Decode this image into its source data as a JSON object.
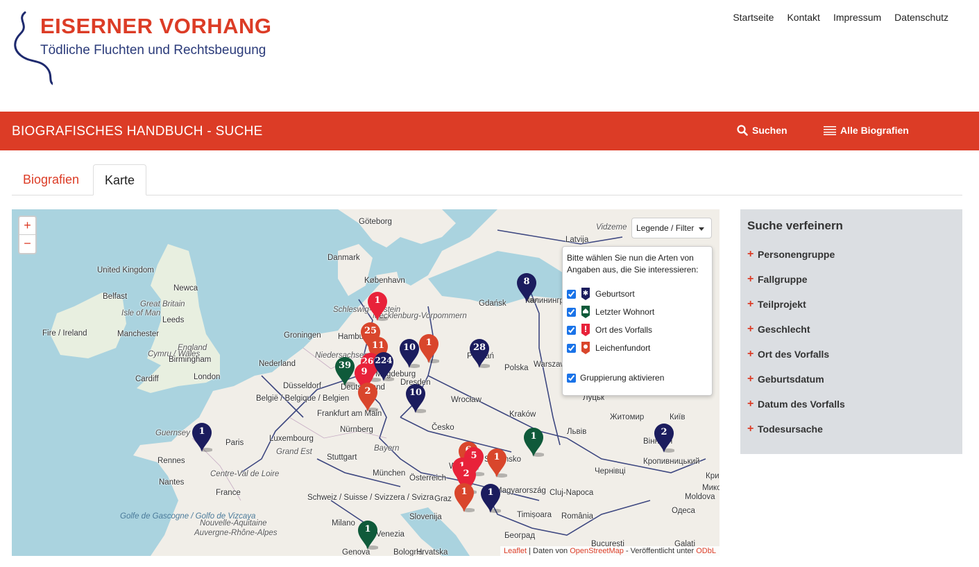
{
  "header": {
    "logo_title": "EISERNER VORHANG",
    "logo_subtitle": "Tödliche Fluchten und Rechtsbeugung",
    "nav": [
      "Startseite",
      "Kontakt",
      "Impressum",
      "Datenschutz"
    ]
  },
  "bar": {
    "title": "BIOGRAFISCHES HANDBUCH - SUCHE",
    "search_label": "Suchen",
    "all_label": "Alle Biografien",
    "color": "#dc3c26"
  },
  "tabs": [
    {
      "label": "Biografien",
      "active": false
    },
    {
      "label": "Karte",
      "active": true
    }
  ],
  "map": {
    "zoom_in": "+",
    "zoom_out": "−",
    "attribution": {
      "leaflet": "Leaflet",
      "sep1": " | Daten von ",
      "osm": "OpenStreetMap",
      "sep2": " - Veröffentlicht unter ",
      "odbl": "ODbL"
    },
    "places": [
      {
        "name": "Göteborg",
        "type": "city"
      },
      {
        "name": "Danmark",
        "type": "country"
      },
      {
        "name": "København",
        "type": "city"
      },
      {
        "name": "Latvija",
        "type": "country"
      },
      {
        "name": "Vidzeme",
        "type": "region"
      },
      {
        "name": "United Kingdom",
        "type": "country"
      },
      {
        "name": "Newca",
        "type": "city"
      },
      {
        "name": "Belfast",
        "type": "city"
      },
      {
        "name": "Great Britain",
        "type": "island"
      },
      {
        "name": "Isle of Man",
        "type": "island"
      },
      {
        "name": "Leeds",
        "type": "city"
      },
      {
        "name": "Fire / Ireland",
        "type": "country"
      },
      {
        "name": "Manchester",
        "type": "city"
      },
      {
        "name": "England",
        "type": "region"
      },
      {
        "name": "Cymru / Wales",
        "type": "region"
      },
      {
        "name": "Birmingham",
        "type": "city"
      },
      {
        "name": "Cardiff",
        "type": "city"
      },
      {
        "name": "London",
        "type": "city"
      },
      {
        "name": "Groningen",
        "type": "city"
      },
      {
        "name": "Nederland",
        "type": "country"
      },
      {
        "name": "Hamburg",
        "type": "city"
      },
      {
        "name": "Niedersachsen",
        "type": "region"
      },
      {
        "name": "Schleswig-Holstein",
        "type": "region"
      },
      {
        "name": "Mecklenburg-Vorpommern",
        "type": "region"
      },
      {
        "name": "Gdańsk",
        "type": "city"
      },
      {
        "name": "Калининград",
        "type": "city"
      },
      {
        "name": "Poznań",
        "type": "city"
      },
      {
        "name": "Warszawa",
        "type": "city"
      },
      {
        "name": "Polska",
        "type": "country"
      },
      {
        "name": "Düsseldorf",
        "type": "city"
      },
      {
        "name": "Deutschland",
        "type": "country"
      },
      {
        "name": "Magdeburg",
        "type": "city"
      },
      {
        "name": "Dresden",
        "type": "city"
      },
      {
        "name": "België / Belgique / Belgien",
        "type": "country"
      },
      {
        "name": "Frankfurt am Main",
        "type": "city"
      },
      {
        "name": "Wrocław",
        "type": "city"
      },
      {
        "name": "Луцьк",
        "type": "city"
      },
      {
        "name": "Київ",
        "type": "city"
      },
      {
        "name": "Житомир",
        "type": "city"
      },
      {
        "name": "Kraków",
        "type": "city"
      },
      {
        "name": "Česko",
        "type": "country"
      },
      {
        "name": "Львів",
        "type": "city"
      },
      {
        "name": "Guernsey",
        "type": "island"
      },
      {
        "name": "Paris",
        "type": "city"
      },
      {
        "name": "Luxembourg",
        "type": "city"
      },
      {
        "name": "Nürnberg",
        "type": "city"
      },
      {
        "name": "Bayern",
        "type": "region"
      },
      {
        "name": "Stuttgart",
        "type": "city"
      },
      {
        "name": "Grand Est",
        "type": "region"
      },
      {
        "name": "Rennes",
        "type": "city"
      },
      {
        "name": "Nantes",
        "type": "city"
      },
      {
        "name": "Centre-Val de Loire",
        "type": "region"
      },
      {
        "name": "France",
        "type": "country"
      },
      {
        "name": "München",
        "type": "city"
      },
      {
        "name": "Österreich",
        "type": "country"
      },
      {
        "name": "Wien",
        "type": "city"
      },
      {
        "name": "Slovensko",
        "type": "country"
      },
      {
        "name": "Magyarország",
        "type": "country"
      },
      {
        "name": "Cluj-Napoca",
        "type": "city"
      },
      {
        "name": "Чернівці",
        "type": "city"
      },
      {
        "name": "Кропивницький",
        "type": "city"
      },
      {
        "name": "Вінниця",
        "type": "city"
      },
      {
        "name": "Кривий Рі",
        "type": "city"
      },
      {
        "name": "Миколаї",
        "type": "city"
      },
      {
        "name": "Moldova",
        "type": "country"
      },
      {
        "name": "Одеса",
        "type": "city"
      },
      {
        "name": "Schweiz / Suisse / Svizzera / Svizra",
        "type": "country"
      },
      {
        "name": "Graz",
        "type": "city"
      },
      {
        "name": "Slovenija",
        "type": "country"
      },
      {
        "name": "Timișoara",
        "type": "city"
      },
      {
        "name": "România",
        "type": "country"
      },
      {
        "name": "Golfe de Gascogne / Golfo de Vizcaya",
        "type": "water"
      },
      {
        "name": "Nouvelle-Aquitaine",
        "type": "region"
      },
      {
        "name": "Auvergne-Rhône-Alpes",
        "type": "region"
      },
      {
        "name": "Milano",
        "type": "city"
      },
      {
        "name": "Venezia",
        "type": "city"
      },
      {
        "name": "Genova",
        "type": "city"
      },
      {
        "name": "Bologna",
        "type": "city"
      },
      {
        "name": "Hrvatska",
        "type": "country"
      },
      {
        "name": "Београд",
        "type": "city"
      },
      {
        "name": "București",
        "type": "city"
      },
      {
        "name": "Galați",
        "type": "city"
      }
    ],
    "markers": [
      {
        "count": "1",
        "kind": "vorfall"
      },
      {
        "count": "8",
        "kind": "geburt"
      },
      {
        "count": "25",
        "kind": "fund"
      },
      {
        "count": "11",
        "kind": "fund"
      },
      {
        "count": "1",
        "kind": "fund"
      },
      {
        "count": "10",
        "kind": "geburt"
      },
      {
        "count": "28",
        "kind": "geburt"
      },
      {
        "count": "39",
        "kind": "wohnort"
      },
      {
        "count": "260",
        "kind": "vorfall"
      },
      {
        "count": "224",
        "kind": "geburt"
      },
      {
        "count": "9",
        "kind": "vorfall"
      },
      {
        "count": "2",
        "kind": "fund"
      },
      {
        "count": "10",
        "kind": "geburt"
      },
      {
        "count": "1",
        "kind": "geburt"
      },
      {
        "count": "1",
        "kind": "wohnort"
      },
      {
        "count": "2",
        "kind": "geburt"
      },
      {
        "count": "6",
        "kind": "fund"
      },
      {
        "count": "5",
        "kind": "vorfall"
      },
      {
        "count": "1",
        "kind": "fund"
      },
      {
        "count": "1",
        "kind": "vorfall"
      },
      {
        "count": "2",
        "kind": "vorfall"
      },
      {
        "count": "1",
        "kind": "fund"
      },
      {
        "count": "1",
        "kind": "geburt"
      },
      {
        "count": "1",
        "kind": "wohnort"
      }
    ],
    "marker_colors": {
      "geburt": "#1b1c5e",
      "wohnort": "#0f5a3a",
      "vorfall": "#e8223a",
      "fund": "#d9462c"
    }
  },
  "legend": {
    "button": "Legende / Filter",
    "intro": "Bitte wählen Sie nun die Arten von Angaben aus, die Sie interessieren:",
    "items": [
      {
        "label": "Geburtsort",
        "checked": true,
        "icon": "star-icon",
        "color": "#1b1c5e"
      },
      {
        "label": "Letzter Wohnort",
        "checked": true,
        "icon": "house-icon",
        "color": "#0f5a3a"
      },
      {
        "label": "Ort des Vorfalls",
        "checked": true,
        "icon": "exclamation-icon",
        "color": "#e8223a"
      },
      {
        "label": "Leichenfundort",
        "checked": true,
        "icon": "cross-icon",
        "color": "#d9462c"
      }
    ],
    "grouping": {
      "label": "Gruppierung aktivieren",
      "checked": true
    }
  },
  "sidebar": {
    "title": "Suche verfeinern",
    "items": [
      "Personengruppe",
      "Fallgruppe",
      "Teilprojekt",
      "Geschlecht",
      "Ort des Vorfalls",
      "Geburtsdatum",
      "Datum des Vorfalls",
      "Todesursache"
    ]
  }
}
